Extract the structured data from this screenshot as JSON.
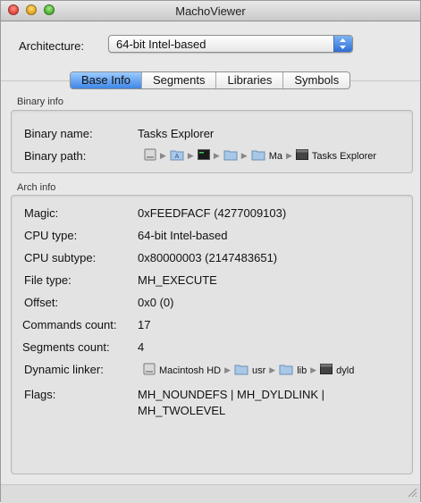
{
  "window": {
    "title": "MachoViewer"
  },
  "architecture": {
    "label": "Architecture:",
    "selected": "64-bit Intel-based"
  },
  "tabs": [
    {
      "label": "Base Info",
      "active": true
    },
    {
      "label": "Segments",
      "active": false
    },
    {
      "label": "Libraries",
      "active": false
    },
    {
      "label": "Symbols",
      "active": false
    }
  ],
  "binary_info": {
    "section_title": "Binary info",
    "name_label": "Binary name:",
    "name_value": "Tasks Explorer",
    "path_label": "Binary path:",
    "path_segments": [
      {
        "icon": "hard-drive-icon",
        "text": ""
      },
      {
        "icon": "applications-folder-icon",
        "text": ""
      },
      {
        "icon": "terminal-icon",
        "text": ""
      },
      {
        "icon": "folder-icon",
        "text": ""
      },
      {
        "icon": "folder-icon",
        "text": "Ma"
      },
      {
        "icon": "executable-icon",
        "text": "Tasks Explorer"
      }
    ]
  },
  "arch_info": {
    "section_title": "Arch info",
    "rows": {
      "magic": {
        "label": "Magic:",
        "value": "0xFEEDFACF (4277009103)"
      },
      "cpu_type": {
        "label": "CPU type:",
        "value": "64-bit Intel-based"
      },
      "cpu_subtype": {
        "label": "CPU subtype:",
        "value": "0x80000003 (2147483651)"
      },
      "file_type": {
        "label": "File type:",
        "value": "MH_EXECUTE"
      },
      "offset": {
        "label": "Offset:",
        "value": "0x0 (0)"
      },
      "commands_count": {
        "label": "Commands count:",
        "value": "17"
      },
      "segments_count": {
        "label": "Segments count:",
        "value": "4"
      }
    },
    "dylinker_label": "Dynamic linker:",
    "dylinker_segments": [
      {
        "icon": "hard-drive-icon",
        "text": "Macintosh HD"
      },
      {
        "icon": "folder-icon",
        "text": "usr"
      },
      {
        "icon": "folder-icon",
        "text": "lib"
      },
      {
        "icon": "executable-icon",
        "text": "dyld"
      }
    ],
    "flags_label": "Flags:",
    "flags_line1": "MH_NOUNDEFS | MH_DYLDLINK |",
    "flags_line2": "MH_TWOLEVEL"
  },
  "colors": {
    "tab_active": "#3e86e6",
    "window_bg": "#e8e8e8"
  }
}
